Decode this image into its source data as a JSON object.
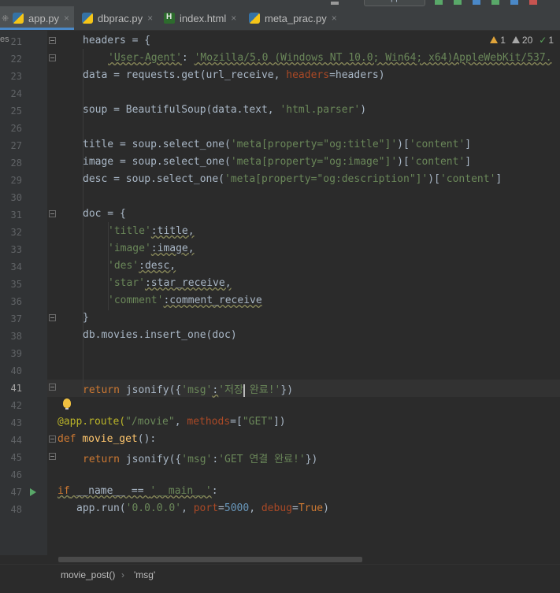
{
  "toolbar": {
    "run_config": "app"
  },
  "tabs": [
    {
      "label": "app.py",
      "icon": "python-file-icon",
      "active": true
    },
    {
      "label": "dbprac.py",
      "icon": "python-file-icon",
      "active": false
    },
    {
      "label": "index.html",
      "icon": "html-file-icon",
      "active": false
    },
    {
      "label": "meta_prac.py",
      "icon": "python-file-icon",
      "active": false
    }
  ],
  "tab_close_glyph": "×",
  "left_edge_text": "es",
  "inspections": {
    "warnings": "1",
    "weak_warnings": "20",
    "typos": "1"
  },
  "line_numbers": [
    "21",
    "22",
    "23",
    "24",
    "25",
    "26",
    "27",
    "28",
    "29",
    "30",
    "31",
    "32",
    "33",
    "34",
    "35",
    "36",
    "37",
    "38",
    "39",
    "40",
    "41",
    "42",
    "43",
    "44",
    "45",
    "46",
    "47",
    "48"
  ],
  "current_line": "41",
  "breadcrumb": {
    "function": "movie_post()",
    "separator": "›",
    "token": "'msg'"
  },
  "code": {
    "l21": {
      "a": "headers = {"
    },
    "l22": {
      "key": "'User-Agent'",
      "sep": ": ",
      "val": "'Mozilla/5.0 (Windows NT 10.0; Win64; x64)AppleWebKit/537."
    },
    "l23": {
      "a": "data = requests.get(url_receive, ",
      "param": "headers",
      "b": "=headers)"
    },
    "l25": {
      "a": "soup = BeautifulSoup(data.text, ",
      "s": "'html.parser'",
      "b": ")"
    },
    "l27": {
      "a": "title = soup.select_one(",
      "s": "'meta[property=\"og:title\"]'",
      "b": ")[",
      "s2": "'content'",
      "c": "]"
    },
    "l28": {
      "a": "image = soup.select_one(",
      "s": "'meta[property=\"og:image\"]'",
      "b": ")[",
      "s2": "'content'",
      "c": "]"
    },
    "l29": {
      "a": "desc = soup.select_one(",
      "s": "'meta[property=\"og:description\"]'",
      "b": ")[",
      "s2": "'content'",
      "c": "]"
    },
    "l31": {
      "a": "doc = {"
    },
    "l32": {
      "s": "'title'",
      "b": ":title,"
    },
    "l33": {
      "s": "'image'",
      "b": ":image,"
    },
    "l34": {
      "s": "'des'",
      "b": ":desc,"
    },
    "l35": {
      "s": "'star'",
      "b": ":star_receive,"
    },
    "l36": {
      "s": "'comment'",
      "b": ":comment_receive"
    },
    "l37": {
      "a": "}"
    },
    "l38": {
      "a": "db.movies.insert_one(doc)"
    },
    "l41": {
      "kw": "return",
      "a": " jsonify({",
      "s": "'msg'",
      "b": ":",
      "s2a": "'저장",
      "s2b": " 완료!'",
      "c": "})"
    },
    "l43": {
      "dec": "@app.route(",
      "s": "\"/movie\"",
      "b": ", ",
      "param": "methods",
      "c": "=[",
      "s2": "\"GET\"",
      "d": "])"
    },
    "l44": {
      "kw": "def",
      "sp": " ",
      "fn": "movie_get",
      "a": "():"
    },
    "l45": {
      "kw": "return",
      "a": " jsonify({",
      "s": "'msg'",
      "b": ":",
      "s2": "'GET 연결 완료!'",
      "c": "})"
    },
    "l47": {
      "kw": "if",
      "a": " __name__ == ",
      "s": "'__main__'",
      "b": ":"
    },
    "l48": {
      "a": "app.run(",
      "s": "'0.0.0.0'",
      "b": ", ",
      "p1": "port",
      "c": "=",
      "n": "5000",
      "d": ", ",
      "p2": "debug",
      "e": "=",
      "kw": "True",
      "f": ")"
    }
  }
}
